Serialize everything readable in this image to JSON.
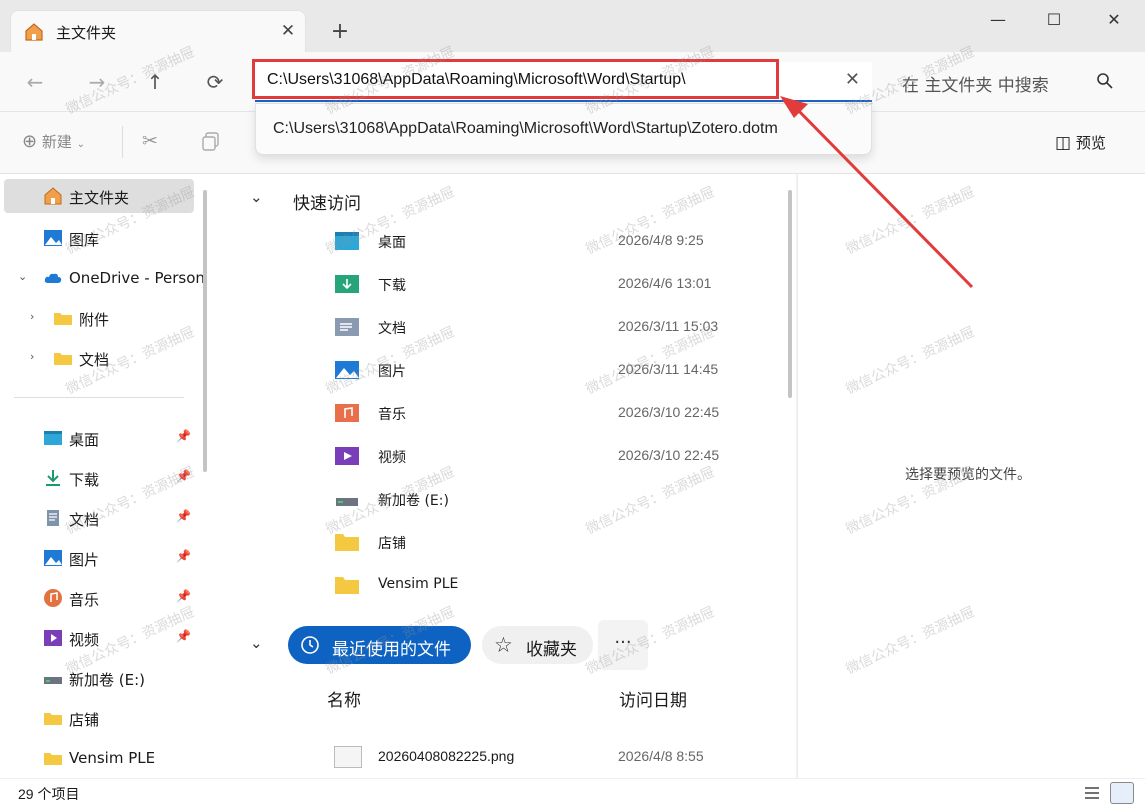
{
  "tab": {
    "title": "主文件夹",
    "icon": "home-icon"
  },
  "window_controls": {
    "minimize": "—",
    "maximize": "☐",
    "close": "✕"
  },
  "nav": {
    "address": "C:\\Users\\31068\\AppData\\Roaming\\Microsoft\\Word\\Startup\\",
    "suggestion": "C:\\Users\\31068\\AppData\\Roaming\\Microsoft\\Word\\Startup\\Zotero.dotm",
    "search_placeholder": "在 主文件夹 中搜索"
  },
  "toolbar": {
    "new_label": "新建",
    "preview_label": "预览"
  },
  "sidebar": {
    "items": [
      {
        "label": "主文件夹",
        "icon": "home-icon"
      },
      {
        "label": "图库",
        "icon": "gallery-icon"
      },
      {
        "label": "OneDrive - Person",
        "icon": "cloud-icon"
      },
      {
        "label": "附件",
        "icon": "folder-icon"
      },
      {
        "label": "文档",
        "icon": "folder-icon"
      }
    ],
    "pinned": [
      {
        "label": "桌面",
        "icon": "desktop-icon"
      },
      {
        "label": "下载",
        "icon": "download-icon"
      },
      {
        "label": "文档",
        "icon": "documents-icon"
      },
      {
        "label": "图片",
        "icon": "pictures-icon"
      },
      {
        "label": "音乐",
        "icon": "music-icon"
      },
      {
        "label": "视频",
        "icon": "video-icon"
      },
      {
        "label": "新加卷 (E:)",
        "icon": "drive-icon"
      },
      {
        "label": "店铺",
        "icon": "folder-icon"
      },
      {
        "label": "Vensim PLE",
        "icon": "folder-icon"
      }
    ]
  },
  "quick_access": {
    "title": "快速访问",
    "items": [
      {
        "name": "桌面",
        "date": "2026/4/8 9:25",
        "icon": "desktop-icon"
      },
      {
        "name": "下载",
        "date": "2026/4/6 13:01",
        "icon": "download-icon"
      },
      {
        "name": "文档",
        "date": "2026/3/11 15:03",
        "icon": "documents-icon"
      },
      {
        "name": "图片",
        "date": "2026/3/11 14:45",
        "icon": "pictures-icon"
      },
      {
        "name": "音乐",
        "date": "2026/3/10 22:45",
        "icon": "music-icon"
      },
      {
        "name": "视频",
        "date": "2026/3/10 22:45",
        "icon": "video-icon"
      },
      {
        "name": "新加卷 (E:)",
        "date": "",
        "icon": "drive-icon"
      },
      {
        "name": "店铺",
        "date": "",
        "icon": "folder-icon"
      },
      {
        "name": "Vensim PLE",
        "date": "",
        "icon": "folder-icon"
      }
    ]
  },
  "recent": {
    "tab_recent": "最近使用的文件",
    "tab_favorites": "收藏夹",
    "more": "···",
    "col_name": "名称",
    "col_date": "访问日期",
    "files": [
      {
        "name": "20260408082225.png",
        "date": "2026/4/8 8:55"
      }
    ]
  },
  "preview": {
    "empty_text": "选择要预览的文件。"
  },
  "status": {
    "count": "29 个项目"
  },
  "watermark": "微信公众号：资源抽屉",
  "colors": {
    "accent": "#0e63c2",
    "highlight": "#e23b3b",
    "folder": "#f5c842"
  }
}
